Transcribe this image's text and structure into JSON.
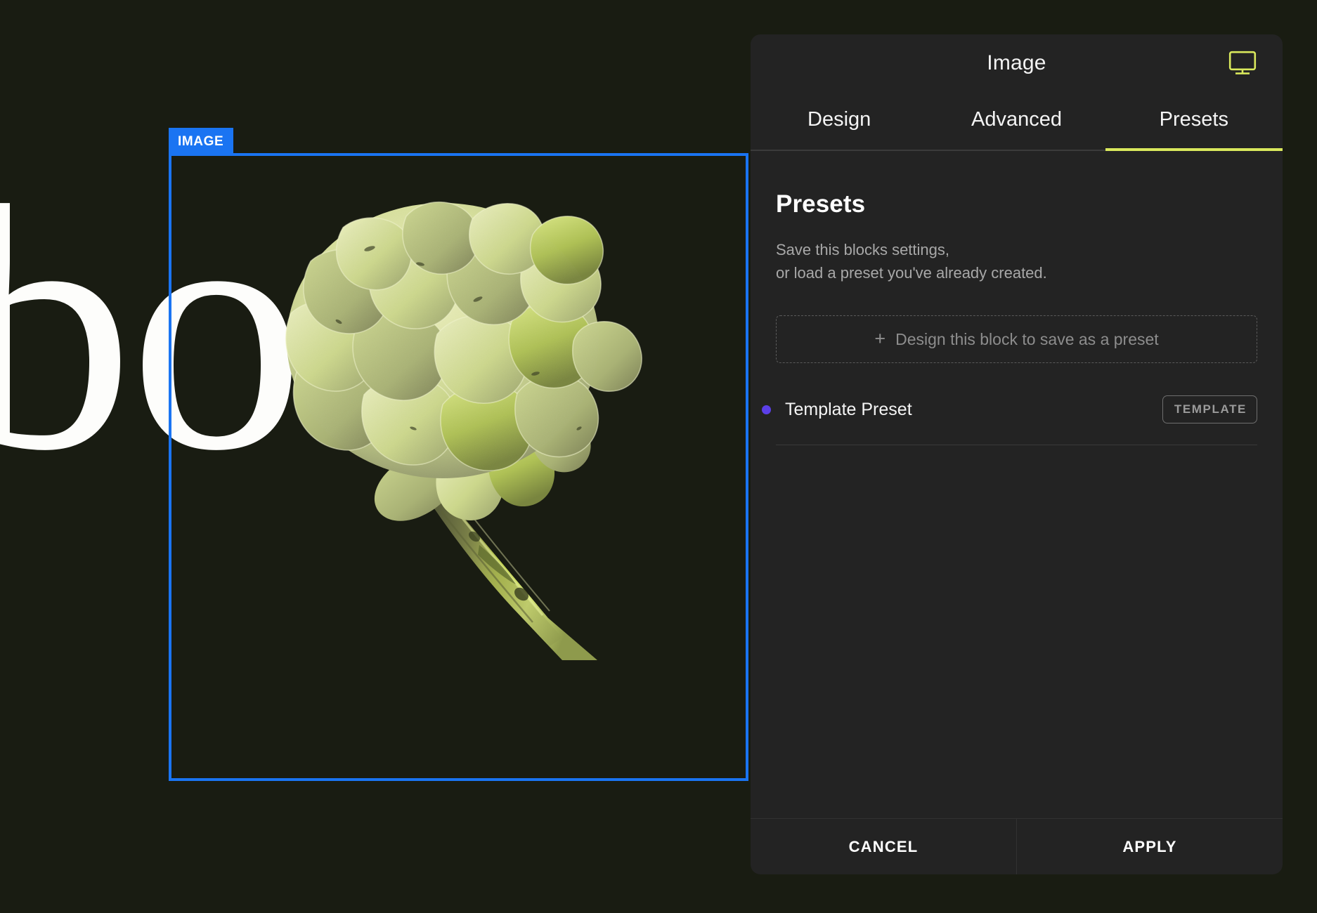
{
  "canvas": {
    "background_color": "#191c12",
    "headline_text": "bout",
    "headline_color": "#fdfdfb",
    "selection": {
      "label": "IMAGE",
      "accent_color": "#1a74f2"
    },
    "image_subject": "artichoke",
    "image_colors": {
      "petal_light": "#e4e9b4",
      "petal_mid": "#c9d585",
      "petal_shadow": "#9aa06f",
      "stem_bright": "#c3d84a",
      "stem_dark": "#6e7340"
    }
  },
  "panel": {
    "title": "Image",
    "device_icon": "desktop-monitor-icon",
    "accent_color": "#d9e85c",
    "tabs": [
      {
        "label": "Design",
        "active": false
      },
      {
        "label": "Advanced",
        "active": false
      },
      {
        "label": "Presets",
        "active": true
      }
    ],
    "presets": {
      "heading": "Presets",
      "description_line1": "Save this blocks settings,",
      "description_line2": "or load a preset you've already created.",
      "save_button": {
        "icon": "plus-icon",
        "label": "Design this block to save as a preset"
      },
      "items": [
        {
          "name": "Template Preset",
          "badge": "TEMPLATE",
          "dot_color": "#5b3fe8"
        }
      ]
    },
    "footer": {
      "cancel_label": "CANCEL",
      "apply_label": "APPLY"
    }
  }
}
